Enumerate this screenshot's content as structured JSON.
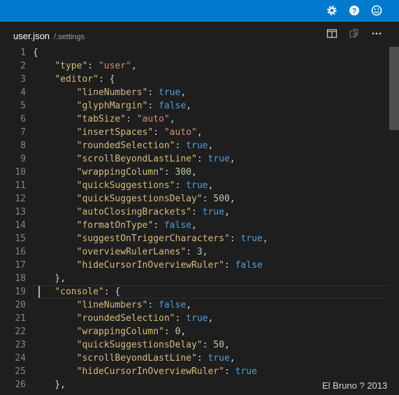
{
  "topbar": {
    "icons": [
      "gear-icon",
      "help-icon",
      "smiley-icon"
    ]
  },
  "tab": {
    "title": "user.json",
    "path": "/.settings",
    "actions": [
      "split-editor-icon",
      "open-changes-icon",
      "more-icon"
    ]
  },
  "editor": {
    "lines": [
      {
        "n": "1",
        "tokens": [
          [
            "punc",
            "{"
          ]
        ]
      },
      {
        "n": "2",
        "tokens": [
          [
            "punc",
            "    "
          ],
          [
            "key",
            "\"type\""
          ],
          [
            "punc",
            ": "
          ],
          [
            "str",
            "\"user\""
          ],
          [
            "punc",
            ","
          ]
        ]
      },
      {
        "n": "3",
        "tokens": [
          [
            "punc",
            "    "
          ],
          [
            "key",
            "\"editor\""
          ],
          [
            "punc",
            ": {"
          ]
        ]
      },
      {
        "n": "4",
        "tokens": [
          [
            "punc",
            "        "
          ],
          [
            "key",
            "\"lineNumbers\""
          ],
          [
            "punc",
            ": "
          ],
          [
            "bool",
            "true"
          ],
          [
            "punc",
            ","
          ]
        ]
      },
      {
        "n": "5",
        "tokens": [
          [
            "punc",
            "        "
          ],
          [
            "key",
            "\"glyphMargin\""
          ],
          [
            "punc",
            ": "
          ],
          [
            "bool",
            "false"
          ],
          [
            "punc",
            ","
          ]
        ]
      },
      {
        "n": "6",
        "tokens": [
          [
            "punc",
            "        "
          ],
          [
            "key",
            "\"tabSize\""
          ],
          [
            "punc",
            ": "
          ],
          [
            "str",
            "\"auto\""
          ],
          [
            "punc",
            ","
          ]
        ]
      },
      {
        "n": "7",
        "tokens": [
          [
            "punc",
            "        "
          ],
          [
            "key",
            "\"insertSpaces\""
          ],
          [
            "punc",
            ": "
          ],
          [
            "str",
            "\"auto\""
          ],
          [
            "punc",
            ","
          ]
        ]
      },
      {
        "n": "8",
        "tokens": [
          [
            "punc",
            "        "
          ],
          [
            "key",
            "\"roundedSelection\""
          ],
          [
            "punc",
            ": "
          ],
          [
            "bool",
            "true"
          ],
          [
            "punc",
            ","
          ]
        ]
      },
      {
        "n": "9",
        "tokens": [
          [
            "punc",
            "        "
          ],
          [
            "key",
            "\"scrollBeyondLastLine\""
          ],
          [
            "punc",
            ": "
          ],
          [
            "bool",
            "true"
          ],
          [
            "punc",
            ","
          ]
        ]
      },
      {
        "n": "10",
        "tokens": [
          [
            "punc",
            "        "
          ],
          [
            "key",
            "\"wrappingColumn\""
          ],
          [
            "punc",
            ": "
          ],
          [
            "num",
            "300"
          ],
          [
            "punc",
            ","
          ]
        ]
      },
      {
        "n": "11",
        "tokens": [
          [
            "punc",
            "        "
          ],
          [
            "key",
            "\"quickSuggestions\""
          ],
          [
            "punc",
            ": "
          ],
          [
            "bool",
            "true"
          ],
          [
            "punc",
            ","
          ]
        ]
      },
      {
        "n": "12",
        "tokens": [
          [
            "punc",
            "        "
          ],
          [
            "key",
            "\"quickSuggestionsDelay\""
          ],
          [
            "punc",
            ": "
          ],
          [
            "num",
            "500"
          ],
          [
            "punc",
            ","
          ]
        ]
      },
      {
        "n": "13",
        "tokens": [
          [
            "punc",
            "        "
          ],
          [
            "key",
            "\"autoClosingBrackets\""
          ],
          [
            "punc",
            ": "
          ],
          [
            "bool",
            "true"
          ],
          [
            "punc",
            ","
          ]
        ]
      },
      {
        "n": "14",
        "tokens": [
          [
            "punc",
            "        "
          ],
          [
            "key",
            "\"formatOnType\""
          ],
          [
            "punc",
            ": "
          ],
          [
            "bool",
            "false"
          ],
          [
            "punc",
            ","
          ]
        ]
      },
      {
        "n": "15",
        "tokens": [
          [
            "punc",
            "        "
          ],
          [
            "key",
            "\"suggestOnTriggerCharacters\""
          ],
          [
            "punc",
            ": "
          ],
          [
            "bool",
            "true"
          ],
          [
            "punc",
            ","
          ]
        ]
      },
      {
        "n": "16",
        "tokens": [
          [
            "punc",
            "        "
          ],
          [
            "key",
            "\"overviewRulerLanes\""
          ],
          [
            "punc",
            ": "
          ],
          [
            "num",
            "3"
          ],
          [
            "punc",
            ","
          ]
        ]
      },
      {
        "n": "17",
        "tokens": [
          [
            "punc",
            "        "
          ],
          [
            "key",
            "\"hideCursorInOverviewRuler\""
          ],
          [
            "punc",
            ": "
          ],
          [
            "bool",
            "false"
          ]
        ]
      },
      {
        "n": "18",
        "tokens": [
          [
            "punc",
            "    },"
          ]
        ]
      },
      {
        "n": "19",
        "tokens": [
          [
            "punc",
            "    "
          ],
          [
            "key",
            "\"console\""
          ],
          [
            "punc",
            ": {"
          ]
        ]
      },
      {
        "n": "20",
        "tokens": [
          [
            "punc",
            "        "
          ],
          [
            "key",
            "\"lineNumbers\""
          ],
          [
            "punc",
            ": "
          ],
          [
            "bool",
            "false"
          ],
          [
            "punc",
            ","
          ]
        ]
      },
      {
        "n": "21",
        "tokens": [
          [
            "punc",
            "        "
          ],
          [
            "key",
            "\"roundedSelection\""
          ],
          [
            "punc",
            ": "
          ],
          [
            "bool",
            "true"
          ],
          [
            "punc",
            ","
          ]
        ]
      },
      {
        "n": "22",
        "tokens": [
          [
            "punc",
            "        "
          ],
          [
            "key",
            "\"wrappingColumn\""
          ],
          [
            "punc",
            ": "
          ],
          [
            "num",
            "0"
          ],
          [
            "punc",
            ","
          ]
        ]
      },
      {
        "n": "23",
        "tokens": [
          [
            "punc",
            "        "
          ],
          [
            "key",
            "\"quickSuggestionsDelay\""
          ],
          [
            "punc",
            ": "
          ],
          [
            "num",
            "50"
          ],
          [
            "punc",
            ","
          ]
        ]
      },
      {
        "n": "24",
        "tokens": [
          [
            "punc",
            "        "
          ],
          [
            "key",
            "\"scrollBeyondLastLine\""
          ],
          [
            "punc",
            ": "
          ],
          [
            "bool",
            "true"
          ],
          [
            "punc",
            ","
          ]
        ]
      },
      {
        "n": "25",
        "tokens": [
          [
            "punc",
            "        "
          ],
          [
            "key",
            "\"hideCursorInOverviewRuler\""
          ],
          [
            "punc",
            ": "
          ],
          [
            "bool",
            "true"
          ]
        ]
      },
      {
        "n": "26",
        "tokens": [
          [
            "punc",
            "    },"
          ]
        ]
      }
    ]
  },
  "watermark": "El Bruno ? 2013",
  "colors": {
    "titlebar": "#007acc",
    "background": "#1e1e1e",
    "key": "#d7ba7d",
    "string": "#ce9178",
    "number": "#b5cea8",
    "boolean": "#569cd6"
  }
}
